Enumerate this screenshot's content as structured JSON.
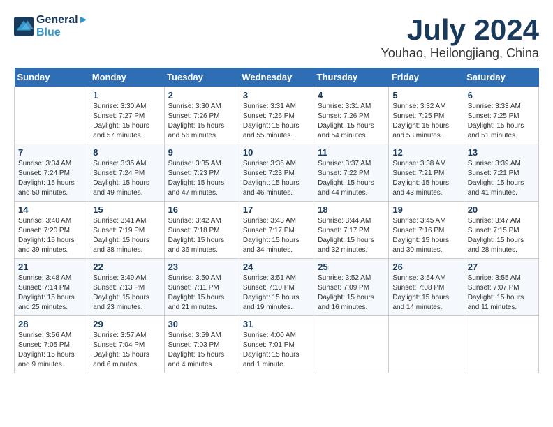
{
  "header": {
    "logo_line1": "General",
    "logo_line2": "Blue",
    "month": "July 2024",
    "location": "Youhao, Heilongjiang, China"
  },
  "weekdays": [
    "Sunday",
    "Monday",
    "Tuesday",
    "Wednesday",
    "Thursday",
    "Friday",
    "Saturday"
  ],
  "weeks": [
    [
      {
        "day": "",
        "info": ""
      },
      {
        "day": "1",
        "info": "Sunrise: 3:30 AM\nSunset: 7:27 PM\nDaylight: 15 hours\nand 57 minutes."
      },
      {
        "day": "2",
        "info": "Sunrise: 3:30 AM\nSunset: 7:26 PM\nDaylight: 15 hours\nand 56 minutes."
      },
      {
        "day": "3",
        "info": "Sunrise: 3:31 AM\nSunset: 7:26 PM\nDaylight: 15 hours\nand 55 minutes."
      },
      {
        "day": "4",
        "info": "Sunrise: 3:31 AM\nSunset: 7:26 PM\nDaylight: 15 hours\nand 54 minutes."
      },
      {
        "day": "5",
        "info": "Sunrise: 3:32 AM\nSunset: 7:25 PM\nDaylight: 15 hours\nand 53 minutes."
      },
      {
        "day": "6",
        "info": "Sunrise: 3:33 AM\nSunset: 7:25 PM\nDaylight: 15 hours\nand 51 minutes."
      }
    ],
    [
      {
        "day": "7",
        "info": "Sunrise: 3:34 AM\nSunset: 7:24 PM\nDaylight: 15 hours\nand 50 minutes."
      },
      {
        "day": "8",
        "info": "Sunrise: 3:35 AM\nSunset: 7:24 PM\nDaylight: 15 hours\nand 49 minutes."
      },
      {
        "day": "9",
        "info": "Sunrise: 3:35 AM\nSunset: 7:23 PM\nDaylight: 15 hours\nand 47 minutes."
      },
      {
        "day": "10",
        "info": "Sunrise: 3:36 AM\nSunset: 7:23 PM\nDaylight: 15 hours\nand 46 minutes."
      },
      {
        "day": "11",
        "info": "Sunrise: 3:37 AM\nSunset: 7:22 PM\nDaylight: 15 hours\nand 44 minutes."
      },
      {
        "day": "12",
        "info": "Sunrise: 3:38 AM\nSunset: 7:21 PM\nDaylight: 15 hours\nand 43 minutes."
      },
      {
        "day": "13",
        "info": "Sunrise: 3:39 AM\nSunset: 7:21 PM\nDaylight: 15 hours\nand 41 minutes."
      }
    ],
    [
      {
        "day": "14",
        "info": "Sunrise: 3:40 AM\nSunset: 7:20 PM\nDaylight: 15 hours\nand 39 minutes."
      },
      {
        "day": "15",
        "info": "Sunrise: 3:41 AM\nSunset: 7:19 PM\nDaylight: 15 hours\nand 38 minutes."
      },
      {
        "day": "16",
        "info": "Sunrise: 3:42 AM\nSunset: 7:18 PM\nDaylight: 15 hours\nand 36 minutes."
      },
      {
        "day": "17",
        "info": "Sunrise: 3:43 AM\nSunset: 7:17 PM\nDaylight: 15 hours\nand 34 minutes."
      },
      {
        "day": "18",
        "info": "Sunrise: 3:44 AM\nSunset: 7:17 PM\nDaylight: 15 hours\nand 32 minutes."
      },
      {
        "day": "19",
        "info": "Sunrise: 3:45 AM\nSunset: 7:16 PM\nDaylight: 15 hours\nand 30 minutes."
      },
      {
        "day": "20",
        "info": "Sunrise: 3:47 AM\nSunset: 7:15 PM\nDaylight: 15 hours\nand 28 minutes."
      }
    ],
    [
      {
        "day": "21",
        "info": "Sunrise: 3:48 AM\nSunset: 7:14 PM\nDaylight: 15 hours\nand 25 minutes."
      },
      {
        "day": "22",
        "info": "Sunrise: 3:49 AM\nSunset: 7:13 PM\nDaylight: 15 hours\nand 23 minutes."
      },
      {
        "day": "23",
        "info": "Sunrise: 3:50 AM\nSunset: 7:11 PM\nDaylight: 15 hours\nand 21 minutes."
      },
      {
        "day": "24",
        "info": "Sunrise: 3:51 AM\nSunset: 7:10 PM\nDaylight: 15 hours\nand 19 minutes."
      },
      {
        "day": "25",
        "info": "Sunrise: 3:52 AM\nSunset: 7:09 PM\nDaylight: 15 hours\nand 16 minutes."
      },
      {
        "day": "26",
        "info": "Sunrise: 3:54 AM\nSunset: 7:08 PM\nDaylight: 15 hours\nand 14 minutes."
      },
      {
        "day": "27",
        "info": "Sunrise: 3:55 AM\nSunset: 7:07 PM\nDaylight: 15 hours\nand 11 minutes."
      }
    ],
    [
      {
        "day": "28",
        "info": "Sunrise: 3:56 AM\nSunset: 7:05 PM\nDaylight: 15 hours\nand 9 minutes."
      },
      {
        "day": "29",
        "info": "Sunrise: 3:57 AM\nSunset: 7:04 PM\nDaylight: 15 hours\nand 6 minutes."
      },
      {
        "day": "30",
        "info": "Sunrise: 3:59 AM\nSunset: 7:03 PM\nDaylight: 15 hours\nand 4 minutes."
      },
      {
        "day": "31",
        "info": "Sunrise: 4:00 AM\nSunset: 7:01 PM\nDaylight: 15 hours\nand 1 minute."
      },
      {
        "day": "",
        "info": ""
      },
      {
        "day": "",
        "info": ""
      },
      {
        "day": "",
        "info": ""
      }
    ]
  ]
}
